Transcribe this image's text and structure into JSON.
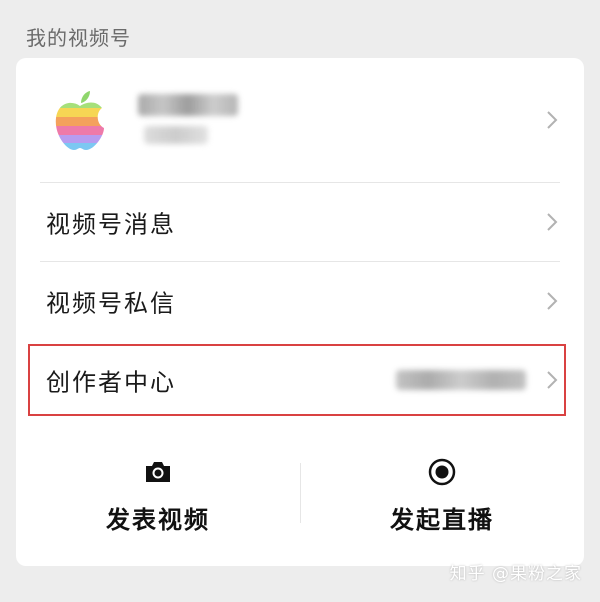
{
  "section_title": "我的视频号",
  "profile": {
    "avatar_icon": "apple-logo-icon"
  },
  "menu": {
    "items": [
      {
        "label": "视频号消息"
      },
      {
        "label": "视频号私信"
      },
      {
        "label": "创作者中心"
      }
    ]
  },
  "actions": [
    {
      "label": "发表视频",
      "icon": "camera-icon"
    },
    {
      "label": "发起直播",
      "icon": "record-icon"
    }
  ],
  "watermark": "知乎 @果粉之家",
  "colors": {
    "background": "#ededed",
    "card": "#ffffff",
    "highlight_border": "#d94141",
    "chevron": "#b2b2b2"
  }
}
